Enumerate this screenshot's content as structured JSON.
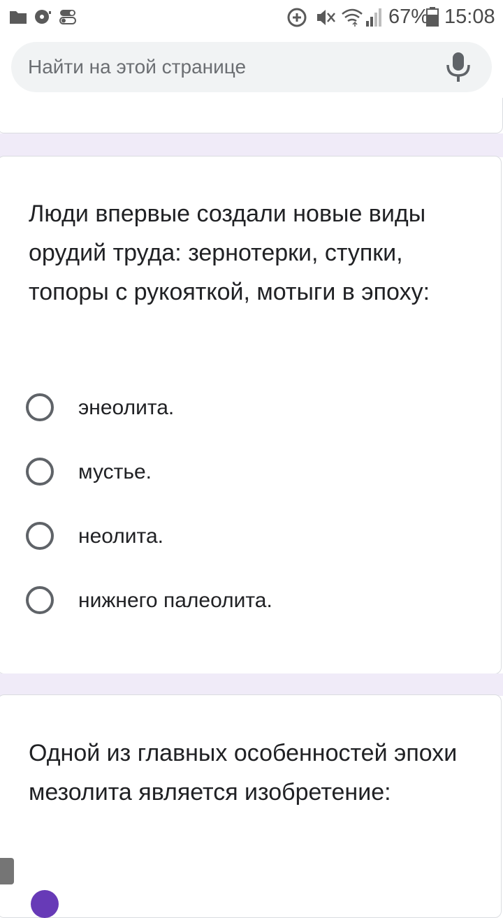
{
  "status_bar": {
    "battery": "67%",
    "time": "15:08"
  },
  "search": {
    "placeholder": "Найти на этой странице"
  },
  "questions": [
    {
      "text": "Люди впервые создали новые виды орудий труда: зернотерки, ступки, топоры с рукояткой, мотыги в эпоху:",
      "options": [
        {
          "label": "энеолита."
        },
        {
          "label": "мустье."
        },
        {
          "label": "неолита."
        },
        {
          "label": "нижнего палеолита."
        }
      ]
    },
    {
      "text": "Одной из главных особенностей эпохи мезолита является изобретение:"
    }
  ],
  "colors": {
    "page_background": "#f0ebf8",
    "accent": "#673ab7",
    "radio_border": "#5f6368",
    "text": "#202124"
  },
  "icons": [
    "folder-icon",
    "disc-icon",
    "toggle-icon",
    "data-saver-icon",
    "mute-icon",
    "wifi-icon",
    "signal-icon",
    "battery-icon",
    "mic-icon"
  ]
}
